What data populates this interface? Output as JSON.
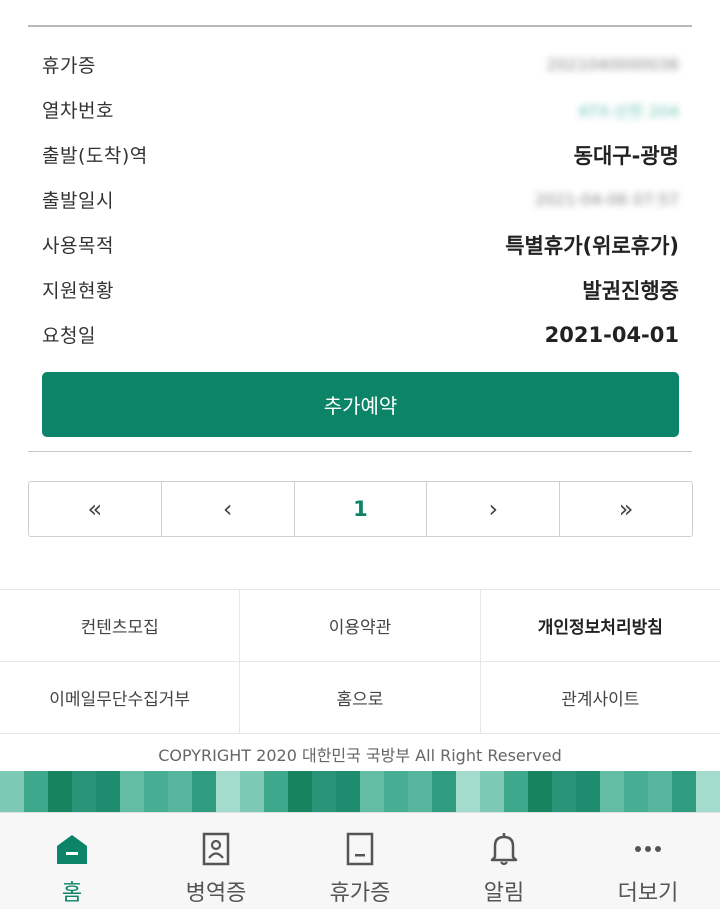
{
  "info": {
    "rows": [
      {
        "label": "휴가증",
        "value": "2021040000036"
      },
      {
        "label": "열차번호",
        "value": "KTX-산천 204"
      },
      {
        "label": "출발(도착)역",
        "value": "동대구-광명"
      },
      {
        "label": "출발일시",
        "value": "2021-04-06 07:57"
      },
      {
        "label": "사용목적",
        "value": "특별휴가(위로휴가)"
      },
      {
        "label": "지원현황",
        "value": "발권진행중"
      },
      {
        "label": "요청일",
        "value": "2021-04-01"
      }
    ]
  },
  "actions": {
    "reserve_label": "추가예약"
  },
  "pager": {
    "first": "«",
    "prev": "‹",
    "current": "1",
    "next": "›",
    "last": "»"
  },
  "footer": {
    "links": [
      "컨텐츠모집",
      "이용약관",
      "개인정보처리방침",
      "이메일무단수집거부",
      "홈으로",
      "관계사이트"
    ],
    "copyright": "COPYRIGHT 2020 대한민국 국방부 All Right Reserved"
  },
  "nav": {
    "items": [
      {
        "label": "홈",
        "icon": "home-icon",
        "active": true
      },
      {
        "label": "병역증",
        "icon": "id-card-icon"
      },
      {
        "label": "휴가증",
        "icon": "leave-pass-icon"
      },
      {
        "label": "알림",
        "icon": "bell-icon"
      },
      {
        "label": "더보기",
        "icon": "more-icon"
      }
    ]
  },
  "colors": {
    "accent": "#0c8467",
    "nav_bg": "#f7f7f7"
  }
}
